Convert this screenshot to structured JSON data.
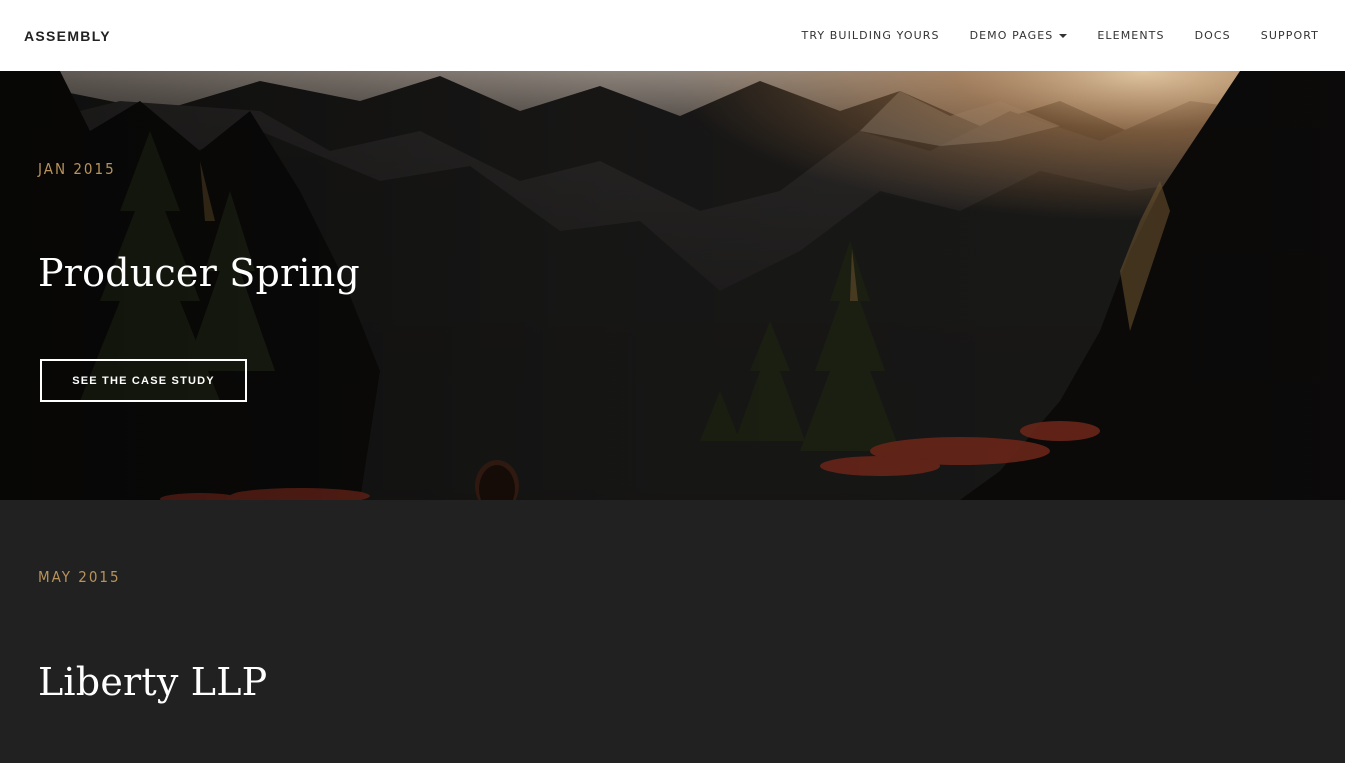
{
  "navbar": {
    "brand": "ASSEMBLY",
    "links": [
      {
        "label": "TRY BUILDING YOURS"
      },
      {
        "label": "DEMO PAGES"
      },
      {
        "label": "ELEMENTS"
      },
      {
        "label": "DOCS"
      },
      {
        "label": "SUPPORT"
      }
    ]
  },
  "hero": {
    "date": "JAN 2015",
    "title": "Producer Spring",
    "cta_label": "SEE THE CASE STUDY"
  },
  "case2": {
    "date": "MAY 2015",
    "title": "Liberty LLP"
  },
  "colors": {
    "accent": "#b8935a",
    "nav_bg": "#ffffff",
    "section_bg": "#212121"
  }
}
